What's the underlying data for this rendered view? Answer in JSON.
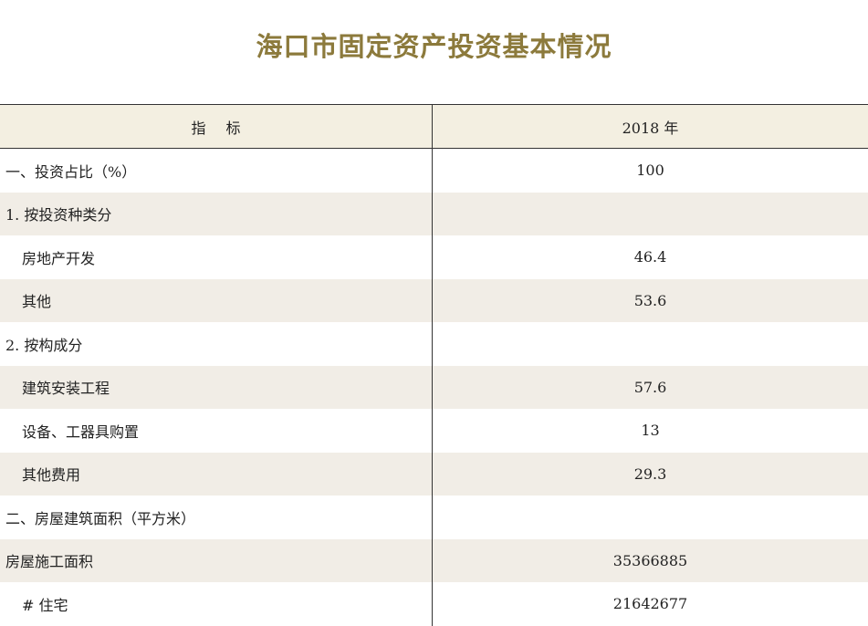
{
  "title": "海口市固定资产投资基本情况",
  "colors": {
    "title": "#8c7a3c",
    "header_bg": "#f3efe1",
    "shade_bg": "#f1ede6"
  },
  "header": {
    "label_part1": "指",
    "label_part2": "标",
    "year": "2018 年"
  },
  "rows": [
    {
      "label": "一、投资占比（%）",
      "value": "100"
    },
    {
      "label": "1. 按投资种类分",
      "value": ""
    },
    {
      "label": "房地产开发",
      "value": "46.4"
    },
    {
      "label": "其他",
      "value": "53.6"
    },
    {
      "label": "2. 按构成分",
      "value": ""
    },
    {
      "label": "建筑安装工程",
      "value": "57.6"
    },
    {
      "label": "设备、工器具购置",
      "value": "13"
    },
    {
      "label": "其他费用",
      "value": "29.3"
    },
    {
      "label": "二、房屋建筑面积（平方米）",
      "value": ""
    },
    {
      "label": "房屋施工面积",
      "value": "35366885"
    },
    {
      "label": "# 住宅",
      "value": "21642677"
    }
  ]
}
